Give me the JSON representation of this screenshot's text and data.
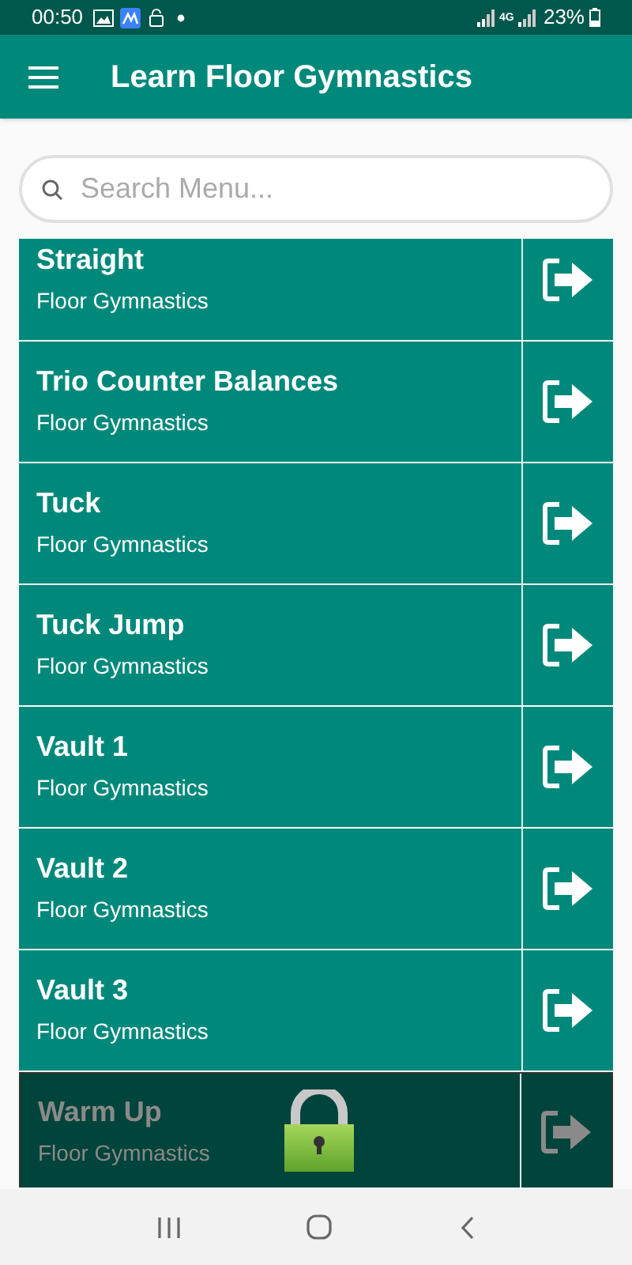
{
  "status_bar": {
    "time": "00:50",
    "network": "4G",
    "battery": "23%"
  },
  "app_bar": {
    "title": "Learn Floor Gymnastics"
  },
  "search": {
    "placeholder": "Search Menu..."
  },
  "items": [
    {
      "title": "Straight",
      "subtitle": "Floor Gymnastics",
      "locked": false
    },
    {
      "title": "Trio Counter Balances",
      "subtitle": "Floor Gymnastics",
      "locked": false
    },
    {
      "title": "Tuck",
      "subtitle": "Floor Gymnastics",
      "locked": false
    },
    {
      "title": "Tuck Jump",
      "subtitle": "Floor Gymnastics",
      "locked": false
    },
    {
      "title": "Vault 1",
      "subtitle": "Floor Gymnastics",
      "locked": false
    },
    {
      "title": "Vault 2",
      "subtitle": "Floor Gymnastics",
      "locked": false
    },
    {
      "title": "Vault 3",
      "subtitle": "Floor Gymnastics",
      "locked": false
    },
    {
      "title": "Warm Up",
      "subtitle": "Floor Gymnastics",
      "locked": true
    }
  ]
}
